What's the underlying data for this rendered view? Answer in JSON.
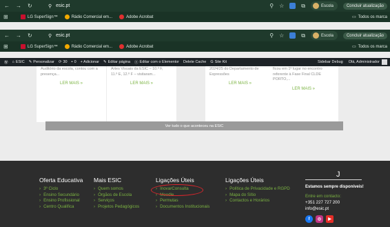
{
  "browser": {
    "url": "esic.pt",
    "profile_name": "Escola",
    "update_label": "Concluir atualização",
    "bookmarks": [
      {
        "label": "LG SuperSign™",
        "icon": "lg-icon",
        "color": "#c8102e"
      },
      {
        "label": "Rádio Comercial em...",
        "icon": "radio-icon",
        "color": "#f2a900"
      },
      {
        "label": "Adobe Acrobat",
        "icon": "acrobat-icon",
        "color": "#e02f2f"
      }
    ],
    "all_bookmarks_label": "Todos os marca"
  },
  "wpbar": {
    "items": [
      "ESIC",
      "Personalizar",
      "30",
      "0",
      "+ Adicionar",
      "Editar página",
      "Editar com o Elementor",
      "Delete Cache",
      "Site Kit"
    ],
    "sidebar_debug": "Sidebar Debug",
    "greeting": "Olá, Administrador"
  },
  "cards": [
    {
      "text": [
        "Auditório da escola, contou com a",
        "presença..."
      ],
      "more": "LER MAIS »"
    },
    {
      "text": [
        "Artes Visuais da ESIC – 10.º F,",
        "11.º E, 12.º F – visitaram..."
      ],
      "more": "LER MAIS »"
    },
    {
      "text": [
        "2024/25 do Departamento de",
        "Expressões"
      ],
      "more": "LER MAIS »"
    },
    {
      "text": [
        "ficou em 1º lugar no encontro",
        "referente à Fase Final CLDE",
        "PORTO,..."
      ],
      "more": "LER MAIS »"
    }
  ],
  "see_all": "Ver tudo o que aconteceu na ESIC",
  "footer": {
    "columns": [
      {
        "title": "Oferta Educativa",
        "links": [
          "3º Ciclo",
          "Ensino Secundário",
          "Ensino Profissional",
          "Centro Qualifica"
        ]
      },
      {
        "title": "Mais ESIC",
        "links": [
          "Quem somos",
          "Órgãos de Escola",
          "Serviços",
          "Projetos Pedagógicos"
        ]
      },
      {
        "title": "Ligações Úteis",
        "links": [
          "InovarConsulta",
          "Moodle",
          "Permutas",
          "Documentos Institucionais"
        ]
      },
      {
        "title": "Ligações Úteis",
        "links": [
          "Política de Privacidade e RGPD",
          "Mapa do Sítio",
          "Contactos e Horários"
        ]
      }
    ],
    "contact": {
      "signature": "J",
      "tagline": "Estamos sempre disponíveis!",
      "cta": "Entre em contacto:",
      "phone": "+351 227 727 200",
      "email": "info@esic.pt"
    },
    "socials": [
      {
        "icon": "facebook-icon",
        "glyph": "f",
        "color": "#1877f2"
      },
      {
        "icon": "instagram-icon",
        "glyph": "◎",
        "color": "#c13584"
      },
      {
        "icon": "youtube-icon",
        "glyph": "▶",
        "color": "#e52d27"
      }
    ]
  },
  "colors": {
    "accent_green": "#7bb342",
    "annotation_red": "#d9262c"
  }
}
